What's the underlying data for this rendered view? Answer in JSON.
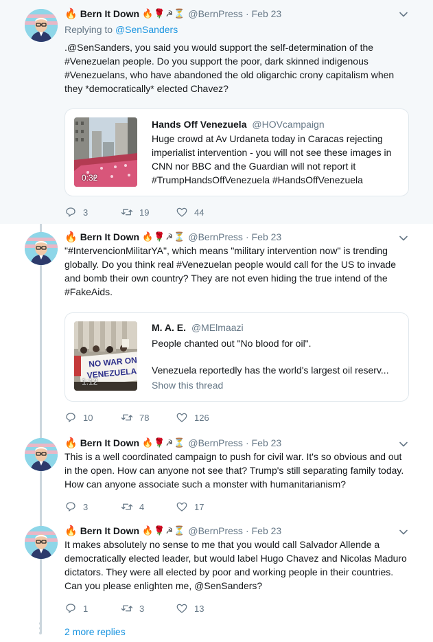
{
  "colors": {
    "link": "#1b95e0",
    "muted": "#657786",
    "thread_line": "#ccd6dd",
    "highlight_bg": "#f5f8fa"
  },
  "tweets": [
    {
      "author": "Bern It Down",
      "handle": "@BernPress",
      "date": "Feb 23",
      "replying_label": "Replying to",
      "replying_to": "@SenSanders",
      "text": ".@SenSanders, you said you would support the self-determination of the #Venezuelan people. Do you support the poor, dark skinned indigenous #Venezuelans, who have  abandoned the old oligarchic crony capitalism when they *democratically* elected Chavez?",
      "quote": {
        "name": "Hands Off Venezuela",
        "handle": "@HOVcampaign",
        "text": "Huge crowd at Av Urdaneta today in Caracas rejecting imperialist intervention - you will not see these images in CNN nor BBC and the Guardian will not report it #TrumpHandsOffVenezuela #HandsOffVenezuela",
        "duration": "0:32"
      },
      "replies": "3",
      "retweets": "19",
      "likes": "44"
    },
    {
      "author": "Bern It Down",
      "handle": "@BernPress",
      "date": "Feb 23",
      "text": "\"#IntervencionMilitarYA\", which means \"military intervention now\" is trending globally. Do you think real #Venezuelan people would call for the US to invade and bomb their own country? They are not even hiding the true intend of the #FakeAids.",
      "quote": {
        "name": "M. A. E.",
        "handle": "@MElmaazi",
        "text_line1": "People chanted out \"No blood for oil\".",
        "text_line2": "Venezuela reportedly has the world's largest oil reserv...",
        "show_thread": "Show this thread",
        "duration": "1:12",
        "sign_text_1": "NO WAR ON",
        "sign_text_2": "VENEZUELA"
      },
      "replies": "10",
      "retweets": "78",
      "likes": "126"
    },
    {
      "author": "Bern It Down",
      "handle": "@BernPress",
      "date": "Feb 23",
      "text": "This is a well coordinated campaign to push for civil war. It's so obvious and out in the open. How can anyone not see that? Trump's still separating family today. How can anyone associate such a monster with humanitarianism?",
      "replies": "3",
      "retweets": "4",
      "likes": "17"
    },
    {
      "author": "Bern It Down",
      "handle": "@BernPress",
      "date": "Feb 23",
      "text": "It makes absolutely no sense to me that you would call Salvador Allende a democratically elected leader, but would label Hugo Chavez and Nicolas Maduro dictators. They were all elected by poor and working people in their countries. Can you please enlighten me, @SenSanders?",
      "replies": "1",
      "retweets": "3",
      "likes": "13"
    }
  ],
  "more_replies": "2 more replies",
  "icons": [
    "reply-icon",
    "retweet-icon",
    "like-icon",
    "chevron-down-icon",
    "fire-emoji-icon",
    "rose-emoji-icon",
    "hammer-sickle-emoji-icon",
    "hourglass-emoji-icon"
  ]
}
